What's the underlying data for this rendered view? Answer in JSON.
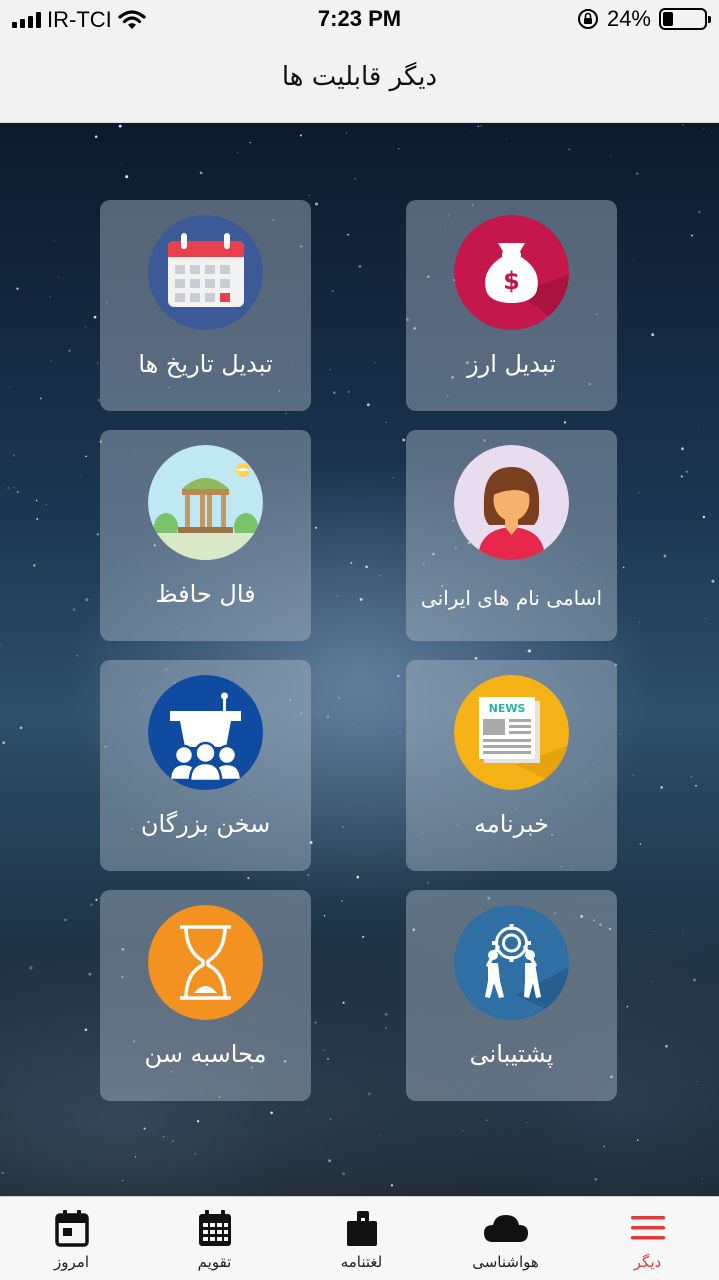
{
  "status_bar": {
    "carrier": "IR-TCI",
    "time": "7:23 PM",
    "battery_percent": "24%",
    "battery_level": 0.24,
    "icons": [
      "signal-icon",
      "wifi-icon",
      "orientation-lock-icon",
      "battery-icon"
    ]
  },
  "header": {
    "title": "دیگر قابلیت ها"
  },
  "tiles": [
    {
      "label": "تبدیل ارز",
      "icon": "money-bag-icon",
      "color": "#c4174b"
    },
    {
      "label": "تبدیل تاریخ ها",
      "icon": "calendar-icon",
      "color": "#3d5a98"
    },
    {
      "label": "اسامی نام های ایرانی",
      "icon": "woman-avatar-icon",
      "color": "#e9dcef"
    },
    {
      "label": "فال حافظ",
      "icon": "hafez-tomb-icon",
      "color": "#bfe8f3"
    },
    {
      "label": "خبرنامه",
      "icon": "newspaper-icon",
      "color": "#f5b216"
    },
    {
      "label": "سخن بزرگان",
      "icon": "speech-podium-icon",
      "color": "#0f4ba0"
    },
    {
      "label": "پشتیبانی",
      "icon": "support-team-icon",
      "color": "#2f6fa3"
    },
    {
      "label": "محاسبه سن",
      "icon": "hourglass-icon",
      "color": "#f39121"
    }
  ],
  "tabs": [
    {
      "label": "دیگر",
      "icon": "menu-icon",
      "active": true,
      "active_color": "#e23a3a"
    },
    {
      "label": "هواشناسی",
      "icon": "cloud-icon",
      "active": false
    },
    {
      "label": "لغتنامه",
      "icon": "dictionary-icon",
      "active": false
    },
    {
      "label": "تقویم",
      "icon": "calendar-grid-icon",
      "active": false
    },
    {
      "label": "امروز",
      "icon": "today-calendar-icon",
      "active": false
    }
  ]
}
